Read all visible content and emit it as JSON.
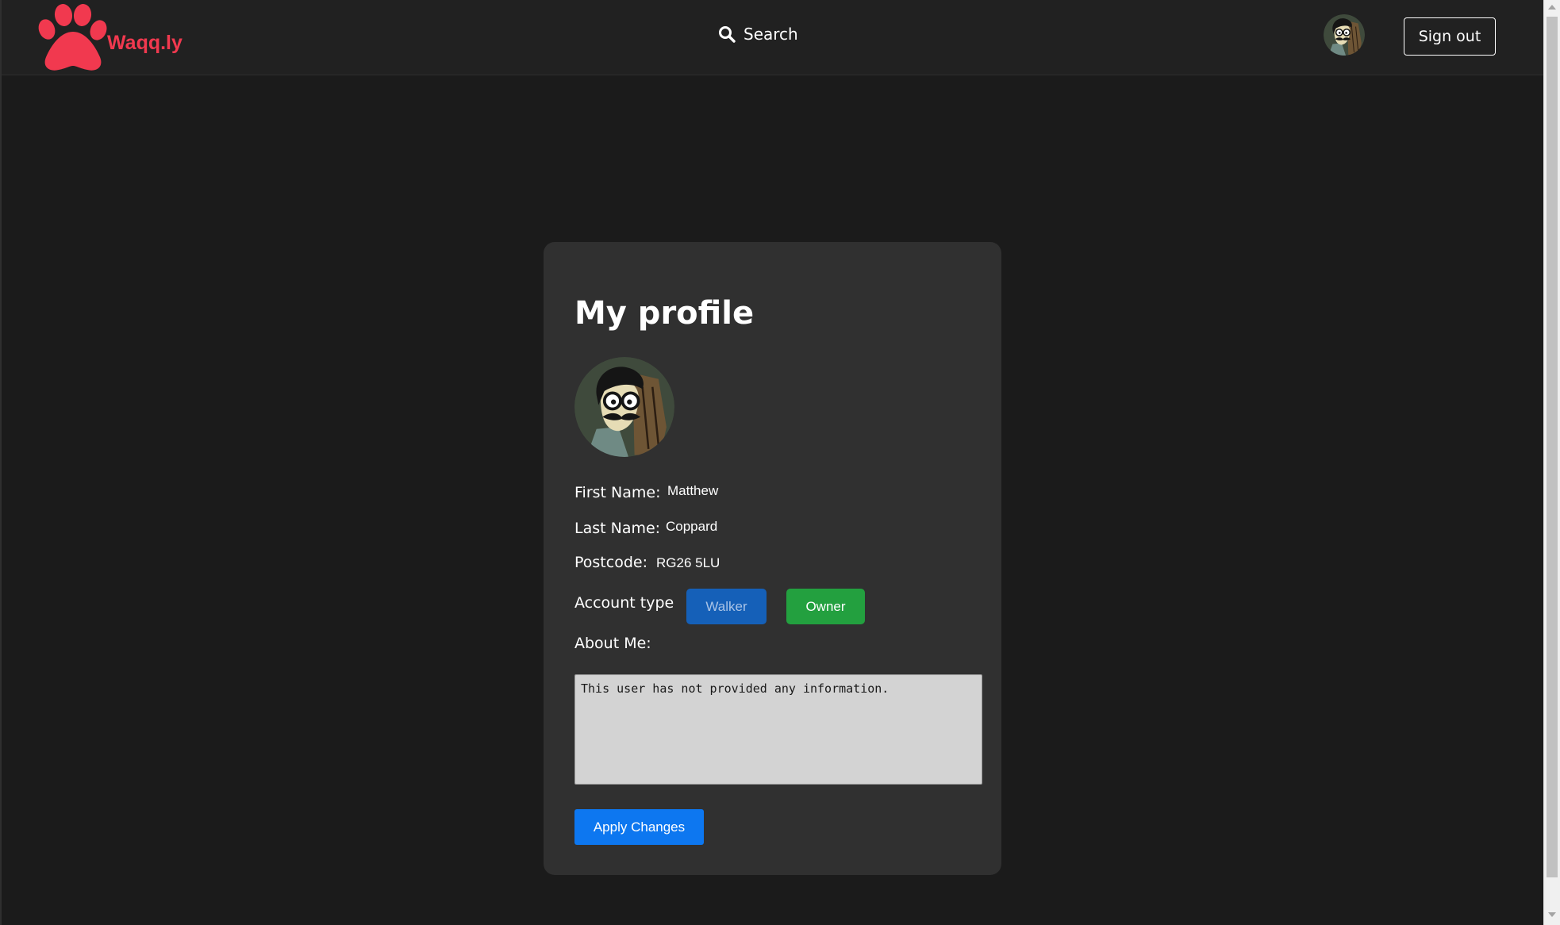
{
  "header": {
    "brand": "Waqq.ly",
    "search_label": "Search",
    "sign_out_label": "Sign out"
  },
  "profile": {
    "title": "My profile",
    "first_name_label": "First Name:",
    "first_name_value": "Matthew",
    "last_name_label": "Last Name:",
    "last_name_value": "Coppard",
    "postcode_label": "Postcode:",
    "postcode_value": "RG26 5LU",
    "account_type_label": "Account type",
    "account_types": {
      "walker": "Walker",
      "owner": "Owner"
    },
    "about_label": "About Me:",
    "about_text": "This user has not provided any information.",
    "apply_label": "Apply Changes"
  },
  "colors": {
    "brand": "#f1394f",
    "background": "#1b1b1b",
    "card": "#303030",
    "walker": "#1560b8",
    "owner": "#23a03f",
    "apply": "#0d77f0"
  },
  "icons": {
    "logo": "paw-icon",
    "search": "search-icon"
  }
}
